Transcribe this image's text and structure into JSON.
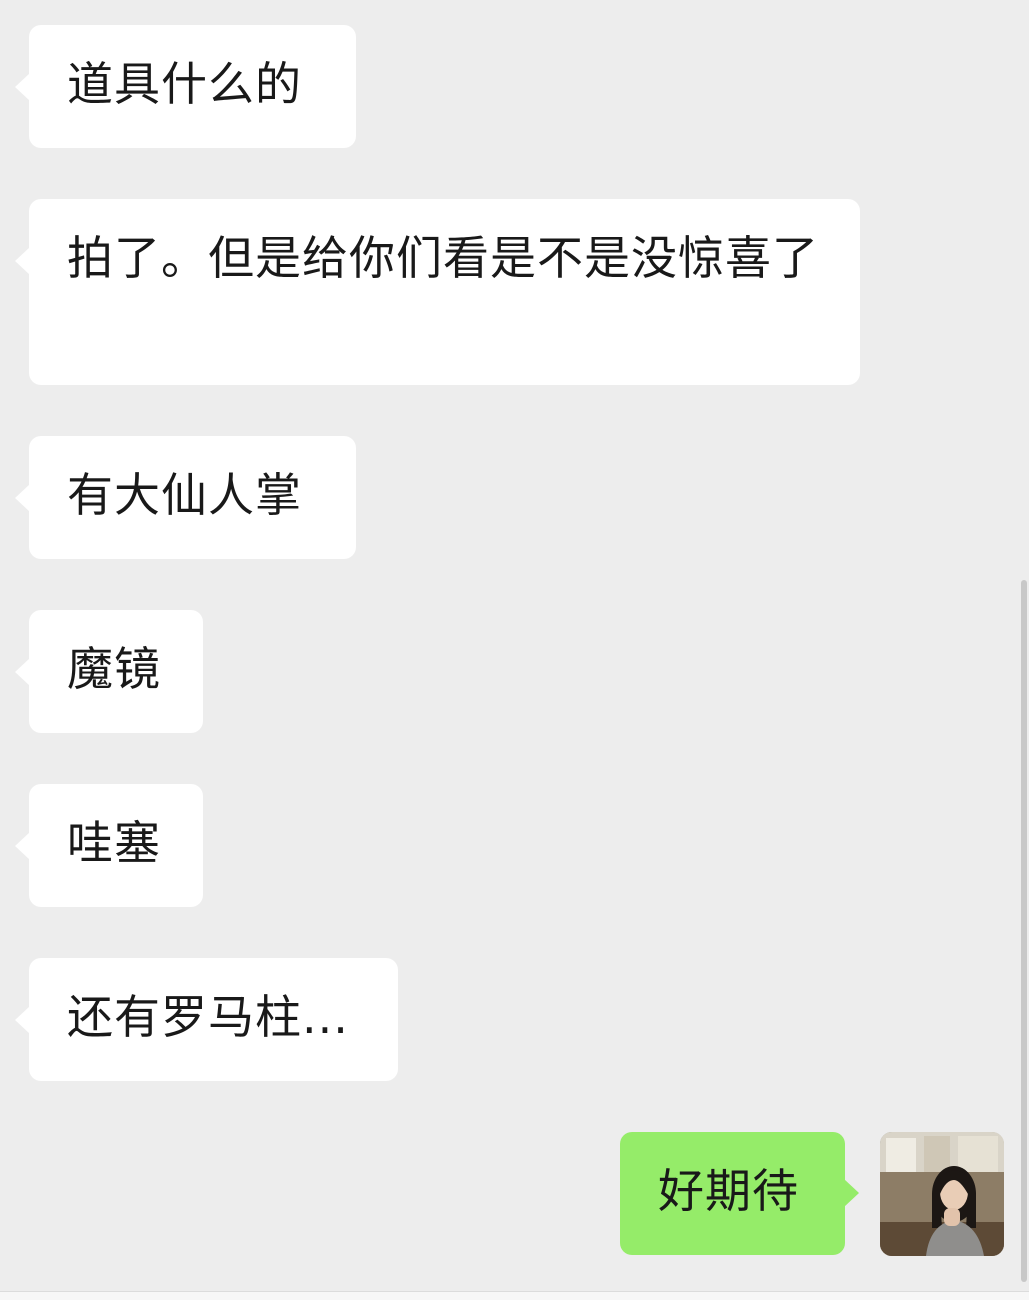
{
  "messages": [
    {
      "side": "incoming",
      "text": "道具什么的"
    },
    {
      "side": "incoming",
      "text": "拍了。但是给你们看是不是没惊喜了"
    },
    {
      "side": "incoming",
      "text": "有大仙人掌"
    },
    {
      "side": "incoming",
      "text": "魔镜"
    },
    {
      "side": "incoming",
      "text": "哇塞"
    },
    {
      "side": "incoming",
      "text": "还有罗马柱..."
    },
    {
      "side": "outgoing",
      "text": "好期待"
    }
  ],
  "colors": {
    "background": "#ededed",
    "incoming_bubble": "#ffffff",
    "outgoing_bubble": "#95ec69",
    "text": "#191919"
  },
  "icons": {
    "avatar": "user-avatar-photo"
  }
}
